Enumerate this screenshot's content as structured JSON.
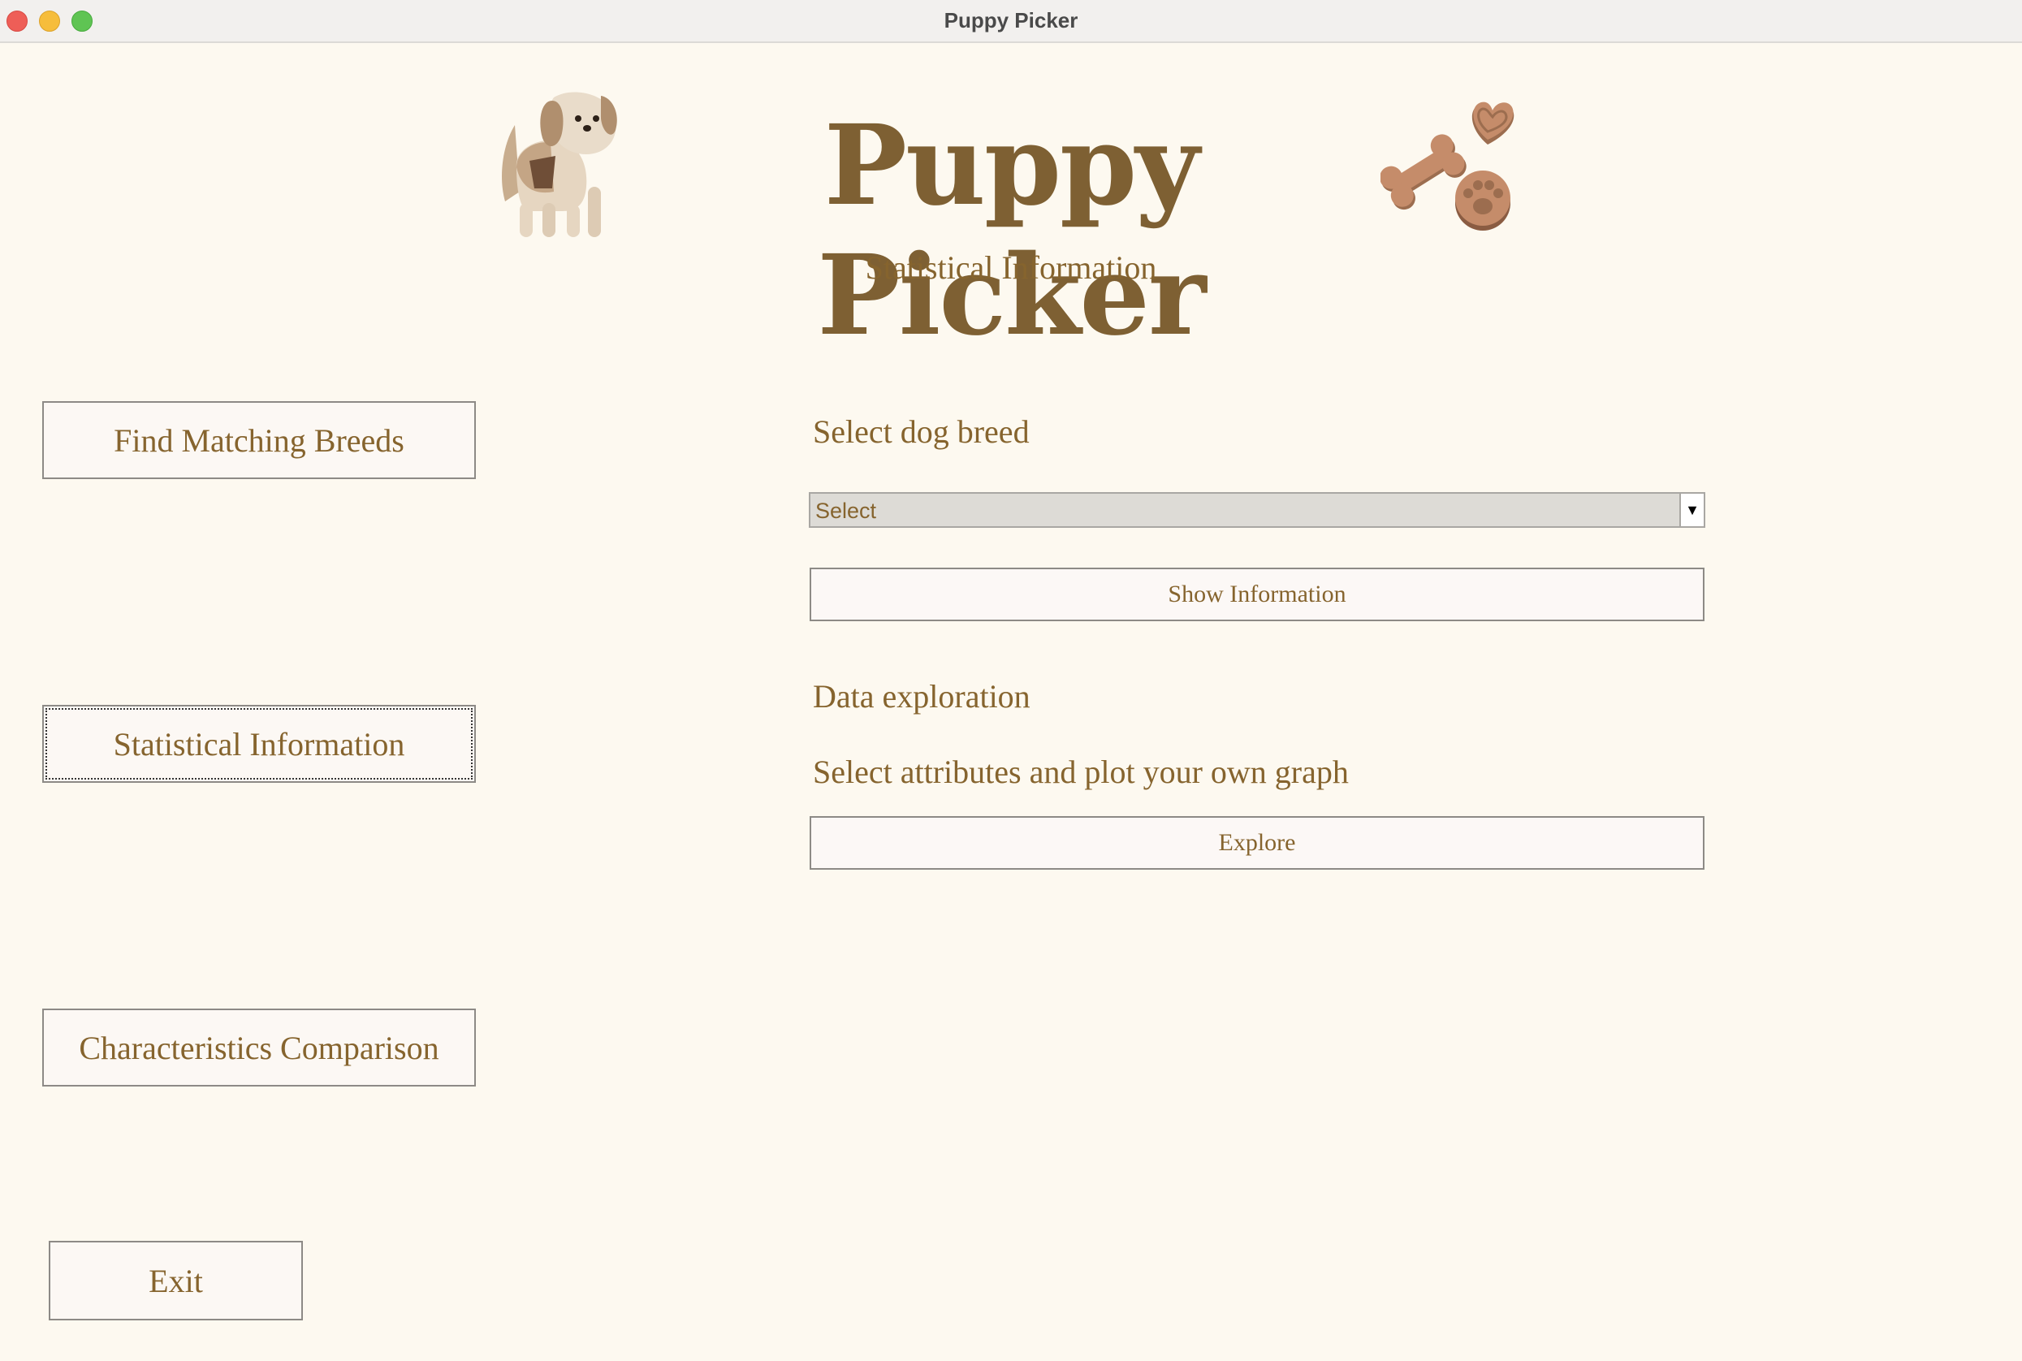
{
  "window": {
    "title": "Puppy Picker"
  },
  "header": {
    "brand": "Puppy Picker",
    "subtitle": "Statistical Information",
    "icons": [
      "dog-illustration-icon",
      "bone-icon",
      "heart-cookie-icon",
      "paw-cookie-icon"
    ]
  },
  "sidebar": {
    "items": [
      {
        "label": "Find Matching Breeds",
        "active": false
      },
      {
        "label": "Statistical Information",
        "active": true
      },
      {
        "label": "Characteristics Comparison",
        "active": false
      }
    ],
    "exit_label": "Exit"
  },
  "main": {
    "breed_label": "Select dog breed",
    "breed_select": {
      "value": "Select",
      "options_visible": [
        "Select"
      ]
    },
    "show_info_label": "Show Information",
    "exploration_heading": "Data exploration",
    "exploration_text": "Select attributes and plot your own graph",
    "explore_label": "Explore"
  },
  "colors": {
    "background": "#fdf9f0",
    "text_brown": "#86642e",
    "brand_brown": "#7e6033",
    "button_bg": "#fcf8f4",
    "select_bg": "#dddbd6"
  }
}
